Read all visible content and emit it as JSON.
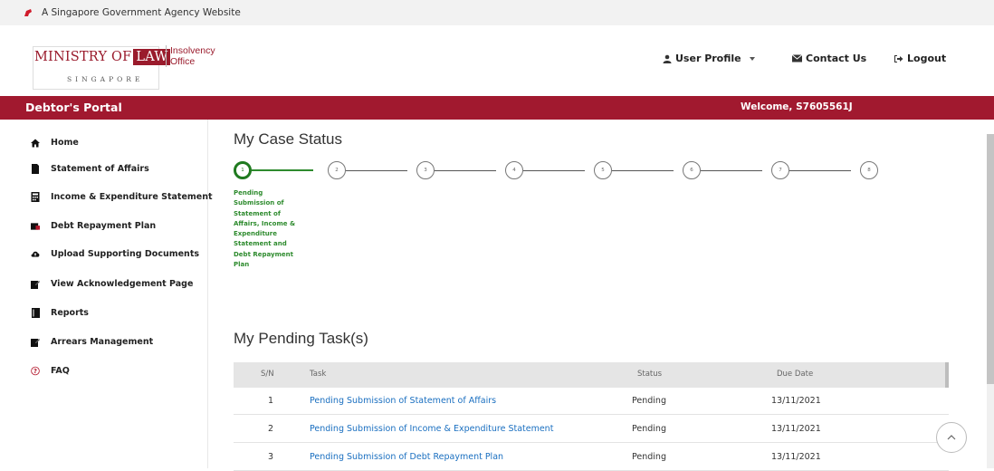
{
  "gov_banner": {
    "text": "A Singapore Government Agency Website",
    "icon": "lion-head-icon"
  },
  "logo": {
    "ministry": "MINISTRY OF",
    "law": "LAW",
    "country": "SINGAPORE",
    "office_line1": "Insolvency",
    "office_line2": "Office"
  },
  "header_actions": {
    "user_profile": "User Profile",
    "contact_us": "Contact Us",
    "logout": "Logout"
  },
  "portal_bar": {
    "title": "Debtor's Portal",
    "welcome": "Welcome, S7605561J",
    "color": "#a1192f"
  },
  "sidebar": {
    "items": [
      {
        "label": "Home",
        "icon": "home-icon"
      },
      {
        "label": "Statement of Affairs",
        "icon": "folder-icon"
      },
      {
        "label": "Income & Expenditure Statement",
        "icon": "calculator-icon"
      },
      {
        "label": "Debt Repayment Plan",
        "icon": "card-icon"
      },
      {
        "label": "Upload Supporting Documents",
        "icon": "cloud-upload-icon"
      },
      {
        "label": "View Acknowledgement Page",
        "icon": "edit-icon"
      },
      {
        "label": "Reports",
        "icon": "book-icon"
      },
      {
        "label": "Arrears Management",
        "icon": "edit-icon"
      },
      {
        "label": "FAQ",
        "icon": "question-icon"
      }
    ]
  },
  "case_status": {
    "heading": "My Case Status",
    "steps": [
      "1",
      "2",
      "3",
      "4",
      "5",
      "6",
      "7",
      "8"
    ],
    "current_step": 1,
    "current_label": "Pending Submission of Statement of Affairs, Income & Expenditure Statement and Debt Repayment Plan",
    "active_color": "#1f7a1f"
  },
  "pending_tasks": {
    "heading": "My Pending Task(s)",
    "columns": [
      "S/N",
      "Task",
      "Status",
      "Due Date"
    ],
    "rows": [
      {
        "sn": "1",
        "task": "Pending Submission of Statement of Affairs",
        "status": "Pending",
        "due": "13/11/2021"
      },
      {
        "sn": "2",
        "task": "Pending Submission of Income & Expenditure Statement",
        "status": "Pending",
        "due": "13/11/2021"
      },
      {
        "sn": "3",
        "task": "Pending Submission of Debt Repayment Plan",
        "status": "Pending",
        "due": "13/11/2021"
      }
    ]
  }
}
